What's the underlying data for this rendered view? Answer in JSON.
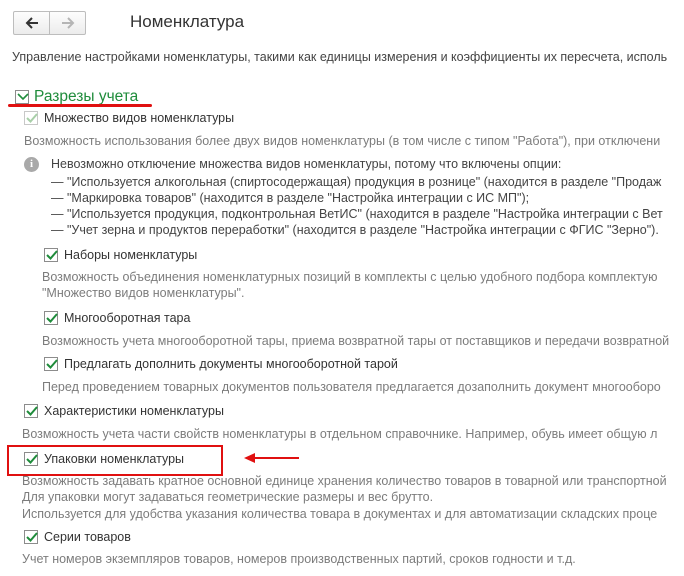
{
  "header": {
    "title": "Номенклатура",
    "back_icon": "arrow-left-icon",
    "forward_icon": "arrow-right-icon"
  },
  "intro": "Управление настройками номенклатуры, такими как единицы измерения и коэффициенты их пересчета, исполь",
  "section": {
    "title": "Разрезы учета",
    "accent_color": "#1f8c3b"
  },
  "options": {
    "multiple_types": {
      "label": "Множество видов номенклатуры",
      "checked": true,
      "disabled": true,
      "description": "Возможность использования более двух видов номенклатуры (в том числе с типом \"Работа\"), при отключени"
    },
    "info": {
      "line1": "Невозможно отключение множества видов номенклатуры, потому что включены опции:",
      "line2": "— \"Используется алкогольная (спиртосодержащая) продукция в рознице\" (находится в разделе \"Продаж",
      "line3": "— \"Маркировка товаров\" (находится в разделе \"Настройка интеграции с ИС МП\");",
      "line4": "— \"Используется продукция, подконтрольная ВетИС\" (находится в разделе \"Настройка интеграции с Вет",
      "line5": "— \"Учет зерна и продуктов переработки\" (находится в разделе \"Настройка интеграции с ФГИС \"Зерно\")."
    },
    "kits": {
      "label": "Наборы номенклатуры",
      "checked": true,
      "description1": "Возможность объединения номенклатурных позиций в комплекты с целью удобного подбора комплектую",
      "description2": "\"Множество видов номенклатуры\"."
    },
    "returnable": {
      "label": "Многооборотная тара",
      "checked": true,
      "description": "Возможность учета многооборотной тары, приема возвратной тары от поставщиков и передачи возвратной"
    },
    "suggest_returnable": {
      "label": "Предлагать дополнить документы многооборотной тарой",
      "checked": true,
      "description": "Перед проведением товарных документов пользователя предлагается дозаполнить документ многооборо"
    },
    "characteristics": {
      "label": "Характеристики номенклатуры",
      "checked": true,
      "description": "Возможность учета части свойств номенклатуры в отдельном справочнике. Например, обувь имеет общую л"
    },
    "packaging": {
      "label": "Упаковки номенклатуры",
      "checked": true,
      "description1": "Возможность задавать кратное основной единице хранения количество товаров в товарной или транспортной",
      "description2": "Для упаковки могут задаваться геометрические размеры и вес брутто.",
      "description3": "Используется для удобства указания количества товара в документах и для автоматизации складских проце"
    },
    "series": {
      "label": "Серии товаров",
      "checked": true,
      "description": "Учет номеров экземпляров товаров, номеров производственных партий, сроков годности и т.д."
    }
  },
  "annotation_color": "#e01010"
}
